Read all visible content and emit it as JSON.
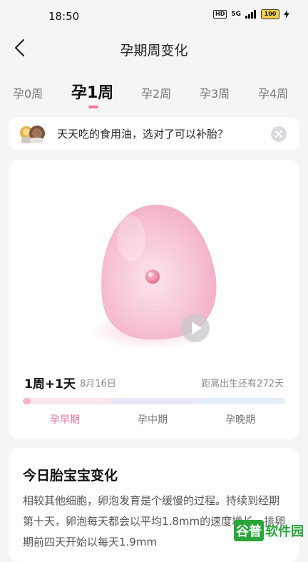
{
  "status_bar": {
    "time": "18:50",
    "hd_badge": "HD",
    "network": "5G",
    "battery": "100"
  },
  "header": {
    "title": "孕期周变化"
  },
  "week_tabs": [
    {
      "label": "孕0周"
    },
    {
      "label": "孕1周"
    },
    {
      "label": "孕2周"
    },
    {
      "label": "孕3周"
    },
    {
      "label": "孕4周"
    }
  ],
  "active_week_index": 1,
  "tip": {
    "text": "天天吃的食用油，选对了可以补胎？"
  },
  "fetus": {
    "week_day": "1周+1天",
    "date": "8月16日",
    "countdown": "距离出生还有272天",
    "progress_fraction": 0.03,
    "stages": [
      {
        "label": "孕早期"
      },
      {
        "label": "孕中期"
      },
      {
        "label": "孕晚期"
      }
    ],
    "active_stage_index": 0
  },
  "change": {
    "title": "今日胎宝宝变化",
    "body": "相较其他细胞，卵泡发育是个缓慢的过程。持续到经期第十天，卵泡每天都会以平均1.8mm的速度增长，排卵期前四天开始以每天1.9mm"
  },
  "watermark": {
    "part1": "谷普",
    "part2": "软件园"
  },
  "colors": {
    "accent": "#e7709c",
    "early": "#fce6ee",
    "mid": "#ece7f8",
    "late": "#e6eef9"
  }
}
